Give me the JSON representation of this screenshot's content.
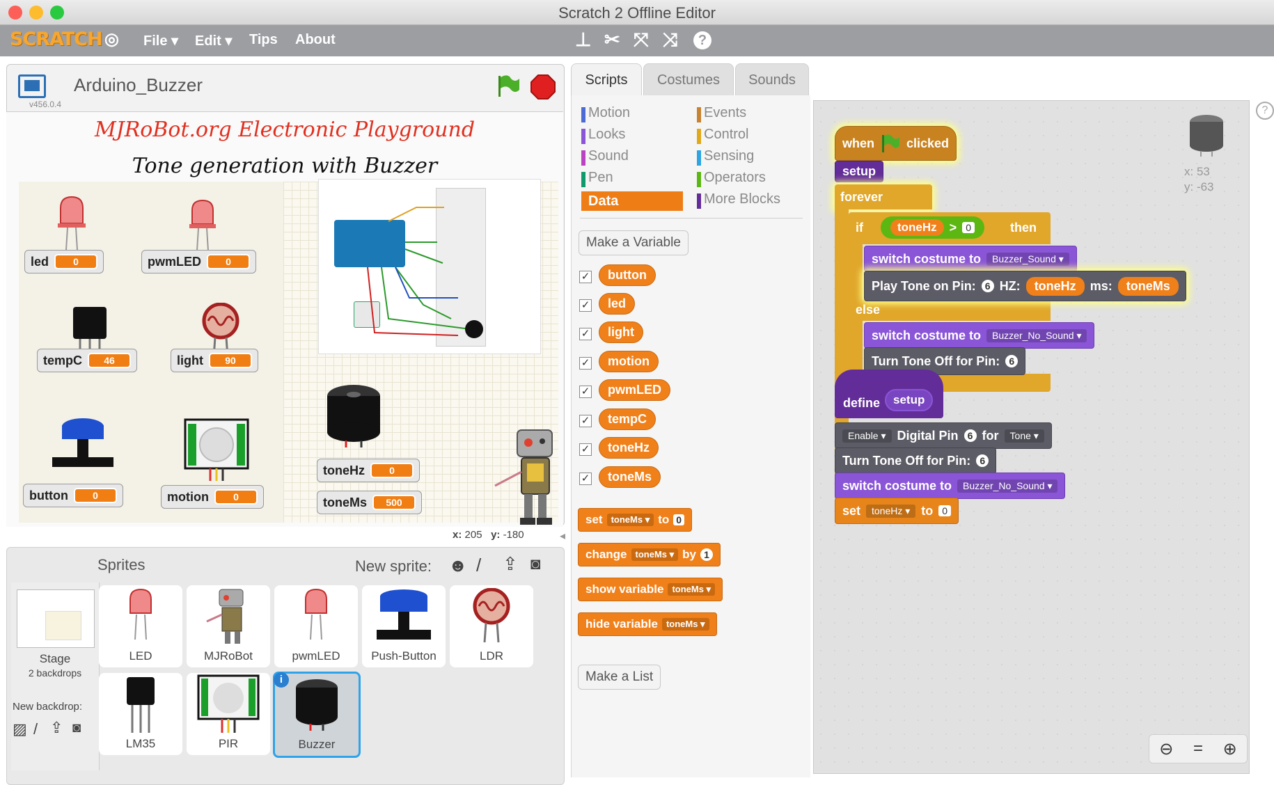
{
  "window": {
    "title": "Scratch 2 Offline Editor"
  },
  "menubar": {
    "logo": "SCRATCH",
    "items": [
      "File ▾",
      "Edit ▾",
      "Tips",
      "About"
    ],
    "tools": [
      "stamp-icon",
      "scissors-icon",
      "grow-icon",
      "shrink-icon",
      "help-icon"
    ]
  },
  "stage": {
    "project_title": "Arduino_Buzzer",
    "version": "v456.0.4",
    "heading1": "MJRoBot.org Electronic Playground",
    "heading2": "Tone generation with Buzzer",
    "monitors": [
      {
        "label": "led",
        "value": "0"
      },
      {
        "label": "pwmLED",
        "value": "0"
      },
      {
        "label": "tempC",
        "value": "46"
      },
      {
        "label": "light",
        "value": "90"
      },
      {
        "label": "button",
        "value": "0"
      },
      {
        "label": "motion",
        "value": "0"
      },
      {
        "label": "toneHz",
        "value": "0"
      },
      {
        "label": "toneMs",
        "value": "500"
      }
    ],
    "mouse_x_label": "x:",
    "mouse_x": "205",
    "mouse_y_label": "y:",
    "mouse_y": "-180",
    "colors": {
      "flag": "#4caf2a",
      "stop": "#e02020"
    }
  },
  "sprites": {
    "title": "Sprites",
    "new_sprite_label": "New sprite:",
    "stage_label": "Stage",
    "stage_sub": "2 backdrops",
    "new_backdrop_label": "New backdrop:",
    "items": [
      "LED",
      "MJRoBot",
      "pwmLED",
      "Push-Button",
      "LDR",
      "LM35",
      "PIR",
      "Buzzer"
    ],
    "selected": "Buzzer"
  },
  "tabs": {
    "scripts": "Scripts",
    "costumes": "Costumes",
    "sounds": "Sounds"
  },
  "palette": {
    "categories_left": [
      {
        "name": "Motion",
        "color": "#4a6cd4"
      },
      {
        "name": "Looks",
        "color": "#8a55d7"
      },
      {
        "name": "Sound",
        "color": "#bb42c3"
      },
      {
        "name": "Pen",
        "color": "#0e9a6c"
      },
      {
        "name": "Data",
        "color": "#ee7d16"
      }
    ],
    "categories_right": [
      {
        "name": "Events",
        "color": "#c88330"
      },
      {
        "name": "Control",
        "color": "#e1a91a"
      },
      {
        "name": "Sensing",
        "color": "#2ca5e2"
      },
      {
        "name": "Operators",
        "color": "#5cb712"
      },
      {
        "name": "More Blocks",
        "color": "#632d99"
      }
    ],
    "make_variable": "Make a Variable",
    "variables": [
      "button",
      "led",
      "light",
      "motion",
      "pwmLED",
      "tempC",
      "toneHz",
      "toneMs"
    ],
    "blocks": {
      "set": "set",
      "set_var": "toneMs",
      "set_to": "to",
      "set_val": "0",
      "change": "change",
      "change_var": "toneMs",
      "change_by": "by",
      "change_val": "1",
      "show": "show variable",
      "show_var": "toneMs",
      "hide": "hide variable",
      "hide_var": "toneMs"
    },
    "make_list": "Make a List"
  },
  "script": {
    "sprite_x": "x: 53",
    "sprite_y": "y: -63",
    "when": "when",
    "clicked": "clicked",
    "setup": "setup",
    "forever": "forever",
    "if": "if",
    "if_var": "toneHz",
    "if_op": ">",
    "if_val": "0",
    "then": "then",
    "switch1": "switch costume to",
    "switch1_val": "Buzzer_Sound",
    "play": "Play Tone on Pin:",
    "play_pin": "6",
    "play_hz": "HZ:",
    "play_hz_var": "toneHz",
    "play_ms": "ms:",
    "play_ms_var": "toneMs",
    "else": "else",
    "switch2": "switch costume to",
    "switch2_val": "Buzzer_No_Sound",
    "turnoff": "Turn Tone Off for Pin:",
    "turnoff_pin": "6",
    "define": "define",
    "define_name": "setup",
    "enable": "Enable",
    "digital": "Digital Pin",
    "digital_pin": "6",
    "for": "for",
    "for_val": "Tone",
    "turnoff2": "Turn Tone Off for Pin:",
    "turnoff2_pin": "6",
    "switch3": "switch costume to",
    "switch3_val": "Buzzer_No_Sound",
    "set2": "set",
    "set2_var": "toneHz",
    "set2_to": "to",
    "set2_val": "0"
  }
}
